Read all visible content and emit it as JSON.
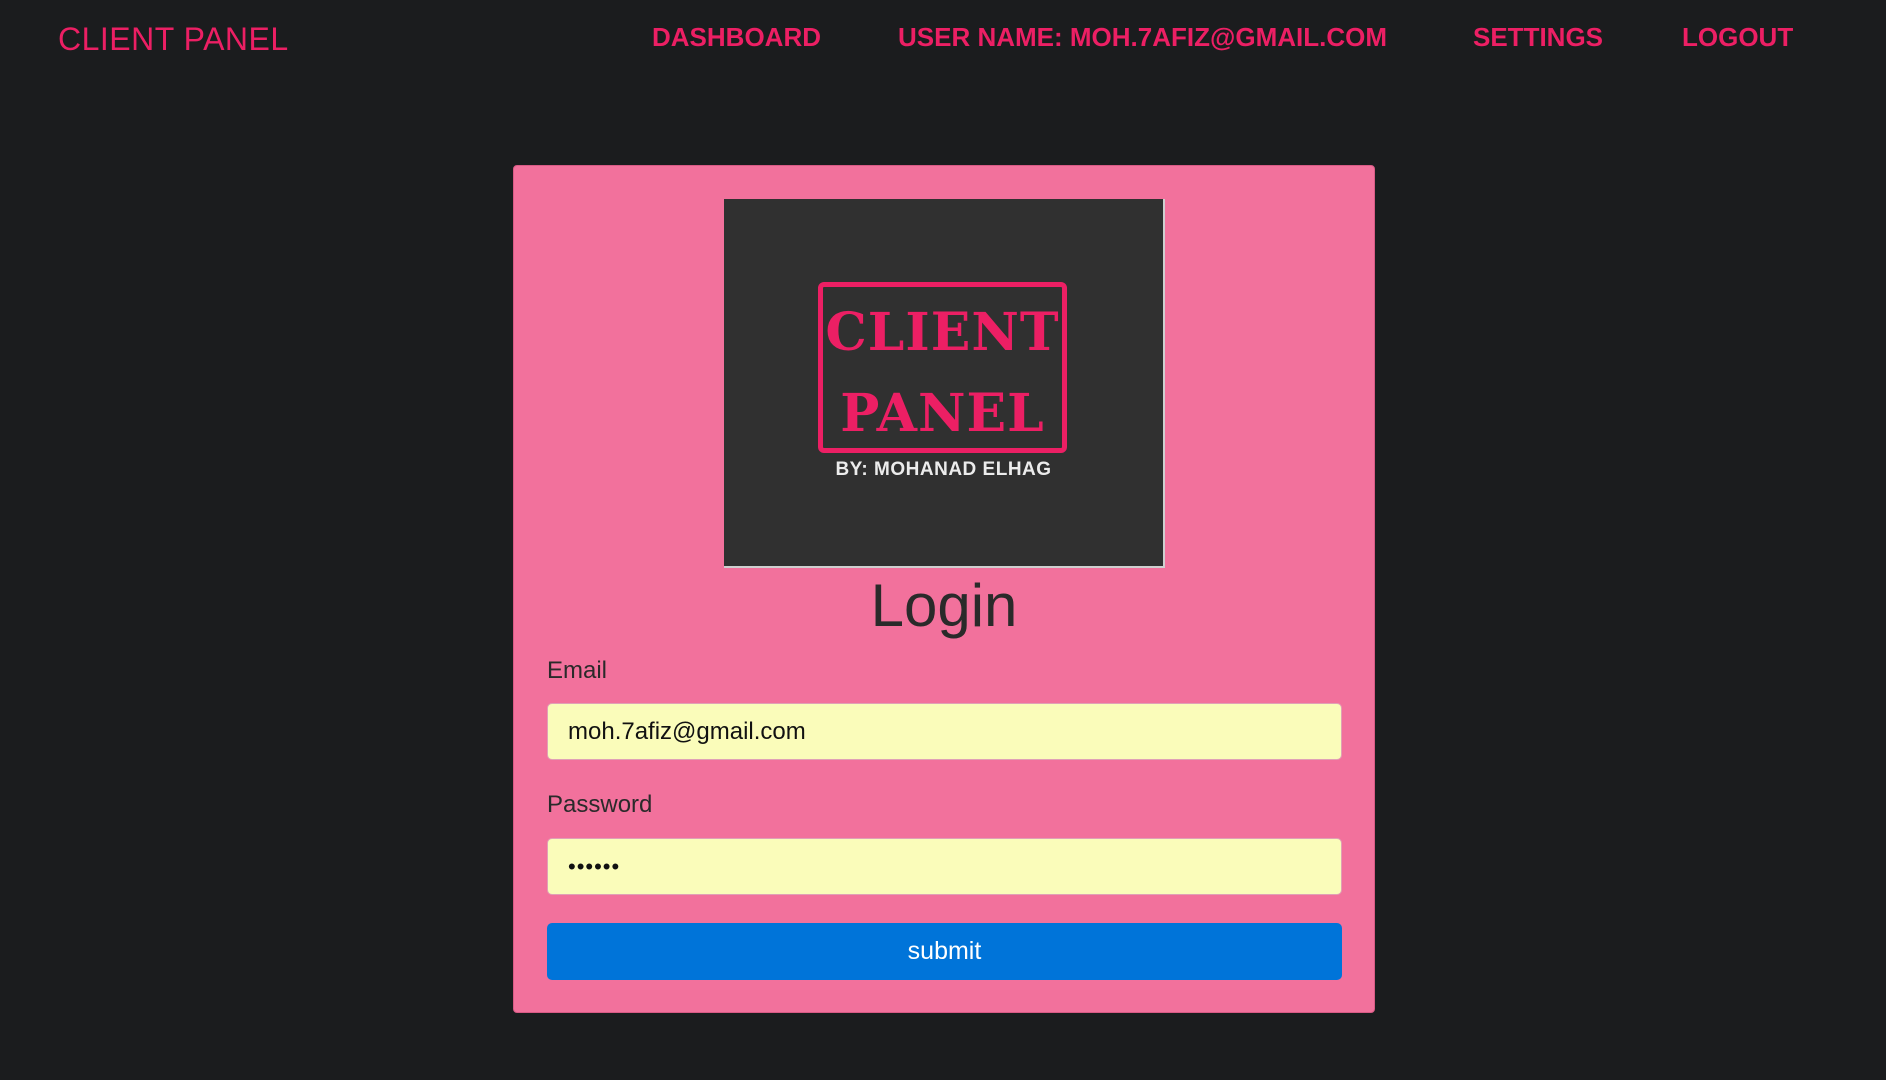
{
  "navbar": {
    "brand": "CLIENT PANEL",
    "links": {
      "dashboard": "DASHBOARD",
      "user": "USER NAME: MOH.7AFIZ@GMAIL.COM",
      "settings": "SETTINGS",
      "logout": "LOGOUT"
    }
  },
  "logo": {
    "line1": "CLIENT",
    "line2": "PANEL",
    "byline": "BY: MOHANAD ELHAG"
  },
  "form": {
    "title": "Login",
    "email_label": "Email",
    "email_value": "moh.7afiz@gmail.com",
    "password_label": "Password",
    "password_value": "••••••",
    "submit_label": "submit"
  },
  "colors": {
    "background": "#1b1c1e",
    "accent": "#ec1f64",
    "card": "#f2719c",
    "input_fill": "#fafcba",
    "button": "#0074d9"
  }
}
